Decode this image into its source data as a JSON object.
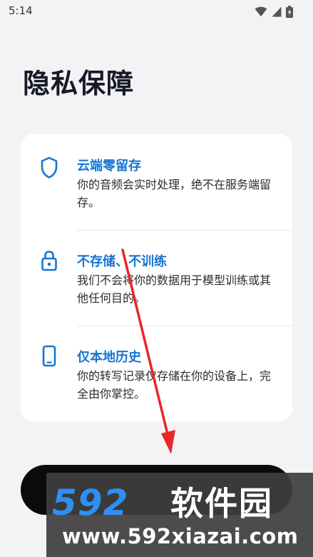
{
  "status_bar": {
    "time": "5:14",
    "icons": [
      "wifi-icon",
      "signal-icon",
      "battery-charging-icon"
    ]
  },
  "page": {
    "title": "隐私保障"
  },
  "features": [
    {
      "icon": "shield-icon",
      "title": "云端零留存",
      "desc": "你的音频会实时处理，绝不在服务端留存。"
    },
    {
      "icon": "lock-icon",
      "title": "不存储、不训练",
      "desc": "我们不会将你的数据用于模型训练或其他任何目的。"
    },
    {
      "icon": "phone-icon",
      "title": "仅本地历史",
      "desc": "你的转写记录仅存储在你的设备上，完全由你掌控。"
    }
  ],
  "watermark": {
    "logo": "592",
    "brand": "软件园",
    "url": "www.592xiazai.com"
  },
  "colors": {
    "accent": "#1676d2",
    "background": "#f3f3f6",
    "card": "#ffffff",
    "button": "#0b0b0b",
    "annotation": "#e8262a"
  }
}
